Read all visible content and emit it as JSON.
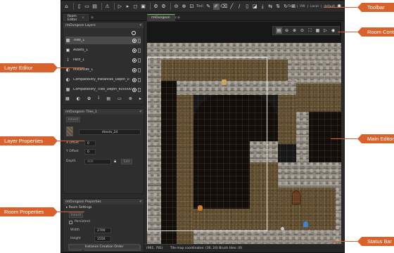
{
  "toolbar": {
    "tool_label": "Tool",
    "top_right": [
      "Text",
      "VW",
      "Local",
      "default"
    ]
  },
  "tabs": {
    "room_editor": "Room Editor",
    "room_name": "rmDungeon"
  },
  "layers_panel": {
    "title": "rmDungeon Layers",
    "layers": [
      {
        "icon": "tile-layer-icon",
        "glyph": "▦",
        "name": "Tiles_1",
        "selected": true
      },
      {
        "icon": "asset-layer-icon",
        "glyph": "▣",
        "name": "Assets_1",
        "selected": false
      },
      {
        "icon": "path-layer-icon",
        "glyph": "⟟",
        "name": "Path_1",
        "selected": false
      },
      {
        "icon": "instance-layer-icon",
        "glyph": "◐",
        "name": "Instances_1",
        "selected": false
      },
      {
        "icon": "instance-layer-icon",
        "glyph": "◐",
        "name": "Compatibility_Instances_Depth_0",
        "selected": false
      },
      {
        "icon": "tile-layer-icon",
        "glyph": "▦",
        "name": "Compatibility_Tiles_Depth_600000",
        "selected": false
      }
    ]
  },
  "layer_props": {
    "title": "rmDungeon: Tiles_1",
    "inherit_btn": "Inherit",
    "tileset": "dtexte_24",
    "x_offset_label": "X Offset",
    "x_offset": "0",
    "y_offset_label": "Y Offset",
    "y_offset": "0",
    "depth_label": "Depth",
    "depth": "400",
    "edit_btn": "Edit"
  },
  "room_props": {
    "title": "rmDungeon Properties",
    "room_settings": "Room Settings",
    "inherit_btn": "Inherit",
    "persistent_label": "Persistent",
    "width_label": "Width",
    "width": "2700",
    "height_label": "Height",
    "height": "1556",
    "inherit_code_btn": "Inherit",
    "creation_code_btn": "Creation Code",
    "instance_order_btn": "Instance Creation Order"
  },
  "status": {
    "coords": "(961, 781)",
    "message": "Tile map coordinates: (30, 24) Brush tiles: (0)"
  },
  "callouts": {
    "toolbar": "Toolbar",
    "room_controls": "Room Controls",
    "layer_editor": "Layer Editor",
    "main_editor": "Main Editor",
    "layer_properties": "Layer Properties",
    "room_properties": "Room Properties",
    "status_bar": "Status Bar"
  },
  "colors": {
    "callout": "#d9622c",
    "panel": "#2e2e2e",
    "rock": "#8a847b",
    "dirt": "#5c4b30"
  }
}
